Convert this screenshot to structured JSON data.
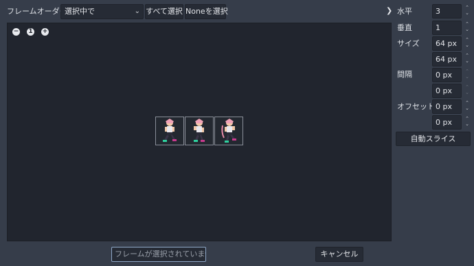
{
  "toolbar": {
    "frame_order_label": "フレームオーダー",
    "frame_order_value": "選択中で",
    "select_all_label": "すべて選択",
    "select_none_label": "Noneを選択",
    "collapse_glyph": "❯"
  },
  "zoom": {
    "out": "−",
    "reset": "1",
    "in": "+"
  },
  "settings": {
    "horizontal_label": "水平",
    "horizontal_value": "3",
    "vertical_label": "垂直",
    "vertical_value": "1",
    "size_label": "サイズ",
    "size_x": "64 px",
    "size_y": "64 px",
    "spacing_label": "間隔",
    "spacing_x": "0 px",
    "spacing_y": "0 px",
    "offset_label": "オフセット",
    "offset_x": "0 px",
    "offset_y": "0 px",
    "auto_slice_label": "自動スライス"
  },
  "footer": {
    "status_text": "フレームが選択されていません",
    "cancel_label": "キャンセル"
  },
  "colors": {
    "accent": "#8fa8c8",
    "viewport": "#21252e",
    "panel": "#363d4a"
  }
}
